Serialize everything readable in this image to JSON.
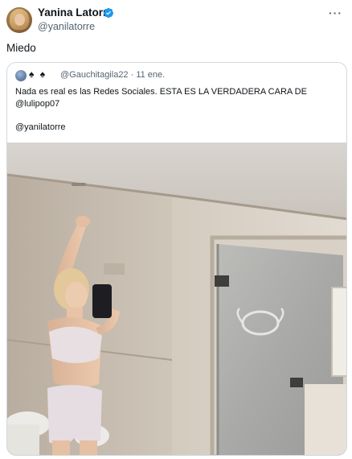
{
  "author": {
    "display_name": "Yanina Latorre",
    "handle": "@yanilatorre",
    "verified_color": "#1d9bf0"
  },
  "more_icon": "more-horizontal-icon",
  "more_label": "···",
  "tweet_text": "Miedo",
  "quoted": {
    "badges": "♠ ♠",
    "handle_time": "@Gauchitagila22 · 11 ene.",
    "text_line1": "Nada es real es las Redes Sociales. ESTA ES LA VERDADERA CARA DE",
    "text_line2": "@lulipop07",
    "text_line3": "@yanilatorre"
  },
  "colors": {
    "text": "#0f1419",
    "secondary": "#536471",
    "border": "#cfd9de",
    "verified": "#1d9bf0"
  }
}
